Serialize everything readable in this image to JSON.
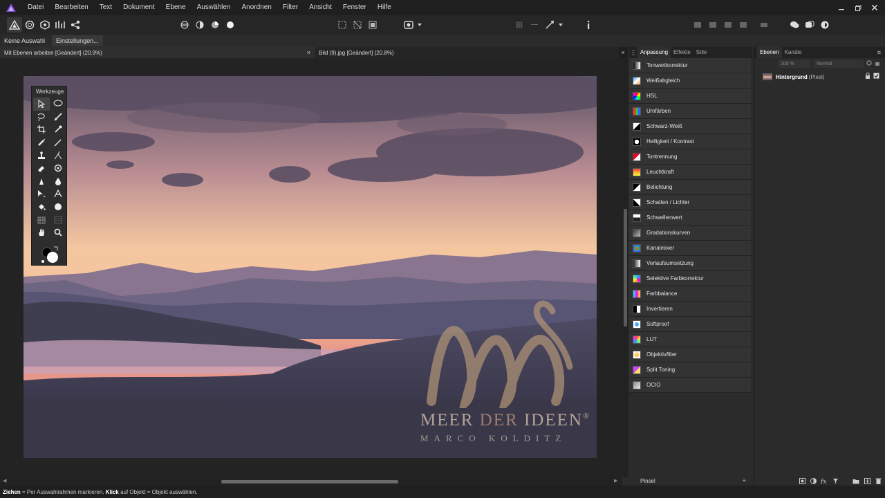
{
  "menu": {
    "items": [
      "Datei",
      "Bearbeiten",
      "Text",
      "Dokument",
      "Ebene",
      "Auswählen",
      "Anordnen",
      "Filter",
      "Ansicht",
      "Fenster",
      "Hilfe"
    ]
  },
  "contextbar": {
    "selection_label": "Keine Auswahl",
    "settings_button": "Einstellungen..."
  },
  "documents": {
    "tabs": [
      {
        "label": "Mit Ebenen arbeiten [Geändert] (20.9%)",
        "close": "×"
      },
      {
        "label": "Bild (9).jpg [Geändert] (20.8%)"
      }
    ],
    "close_all": "×"
  },
  "tools_panel": {
    "title": "Werkzeuge",
    "tools": [
      "move-tool-icon",
      "lasso-select-icon",
      "freehand-select-icon",
      "brush-select-icon",
      "crop-icon",
      "color-picker-icon",
      "paint-brush-icon",
      "pixel-brush-icon",
      "clone-stamp-icon",
      "healing-icon",
      "erase-icon",
      "flood-fill-icon",
      "dodge-icon",
      "smudge-icon",
      "node-icon",
      "text-icon",
      "fill-icon",
      "shape-icon",
      "mesh-warp-icon",
      "grid-icon",
      "hand-icon",
      "zoom-icon"
    ]
  },
  "watermark": {
    "title_a": "MEER ",
    "title_b": "DER",
    "title_c": " IDEEN",
    "registered": "®",
    "subtitle": "MARCO KOLDITZ"
  },
  "statusbar": {
    "b1": "Ziehen",
    "t1": " = Per Auswahlrahmen markieren. ",
    "b2": "Klick",
    "t2": " auf Objekt = Objekt auswählen."
  },
  "adjustments": {
    "tabs": [
      "Anpassung",
      "Effekte",
      "Stile"
    ],
    "items": [
      {
        "label": "Tonwertkorrektur",
        "icon": "levels-icon"
      },
      {
        "label": "Weißabgleich",
        "icon": "white-balance-icon"
      },
      {
        "label": "HSL",
        "icon": "hsl-icon"
      },
      {
        "label": "Umfärben",
        "icon": "recolor-icon"
      },
      {
        "label": "Schwarz-Weiß",
        "icon": "black-white-icon"
      },
      {
        "label": "Helligkeit / Kontrast",
        "icon": "brightness-contrast-icon"
      },
      {
        "label": "Tontrennung",
        "icon": "posterize-icon"
      },
      {
        "label": "Leuchtkraft",
        "icon": "vibrance-icon"
      },
      {
        "label": "Belichtung",
        "icon": "exposure-icon"
      },
      {
        "label": "Schatten / Lichter",
        "icon": "shadows-highlights-icon"
      },
      {
        "label": "Schwellenwert",
        "icon": "threshold-icon"
      },
      {
        "label": "Gradationskurven",
        "icon": "curves-icon"
      },
      {
        "label": "Kanalmixer",
        "icon": "channel-mixer-icon"
      },
      {
        "label": "Verlaufsumsetzung",
        "icon": "gradient-map-icon"
      },
      {
        "label": "Selektive Farbkorrektur",
        "icon": "selective-color-icon"
      },
      {
        "label": "Farbbalance",
        "icon": "color-balance-icon"
      },
      {
        "label": "Invertieren",
        "icon": "invert-icon"
      },
      {
        "label": "Softproof",
        "icon": "soft-proof-icon"
      },
      {
        "label": "LUT",
        "icon": "lut-icon"
      },
      {
        "label": "Objektivfilter",
        "icon": "lens-filter-icon"
      },
      {
        "label": "Split Toning",
        "icon": "split-toning-icon"
      },
      {
        "label": "OCIO",
        "icon": "ocio-icon"
      }
    ],
    "search_value": "Pinsel"
  },
  "layers": {
    "tabs": [
      "Ebenen",
      "Kanäle"
    ],
    "opacity": "100 %",
    "blend_mode": "Normal",
    "layer_name": "Hintergrund",
    "layer_kind": "(Pixel)"
  },
  "colors": {
    "accent": "#7f47dd",
    "menubar": "#1f1f1f",
    "panel": "#2b2b2b"
  }
}
